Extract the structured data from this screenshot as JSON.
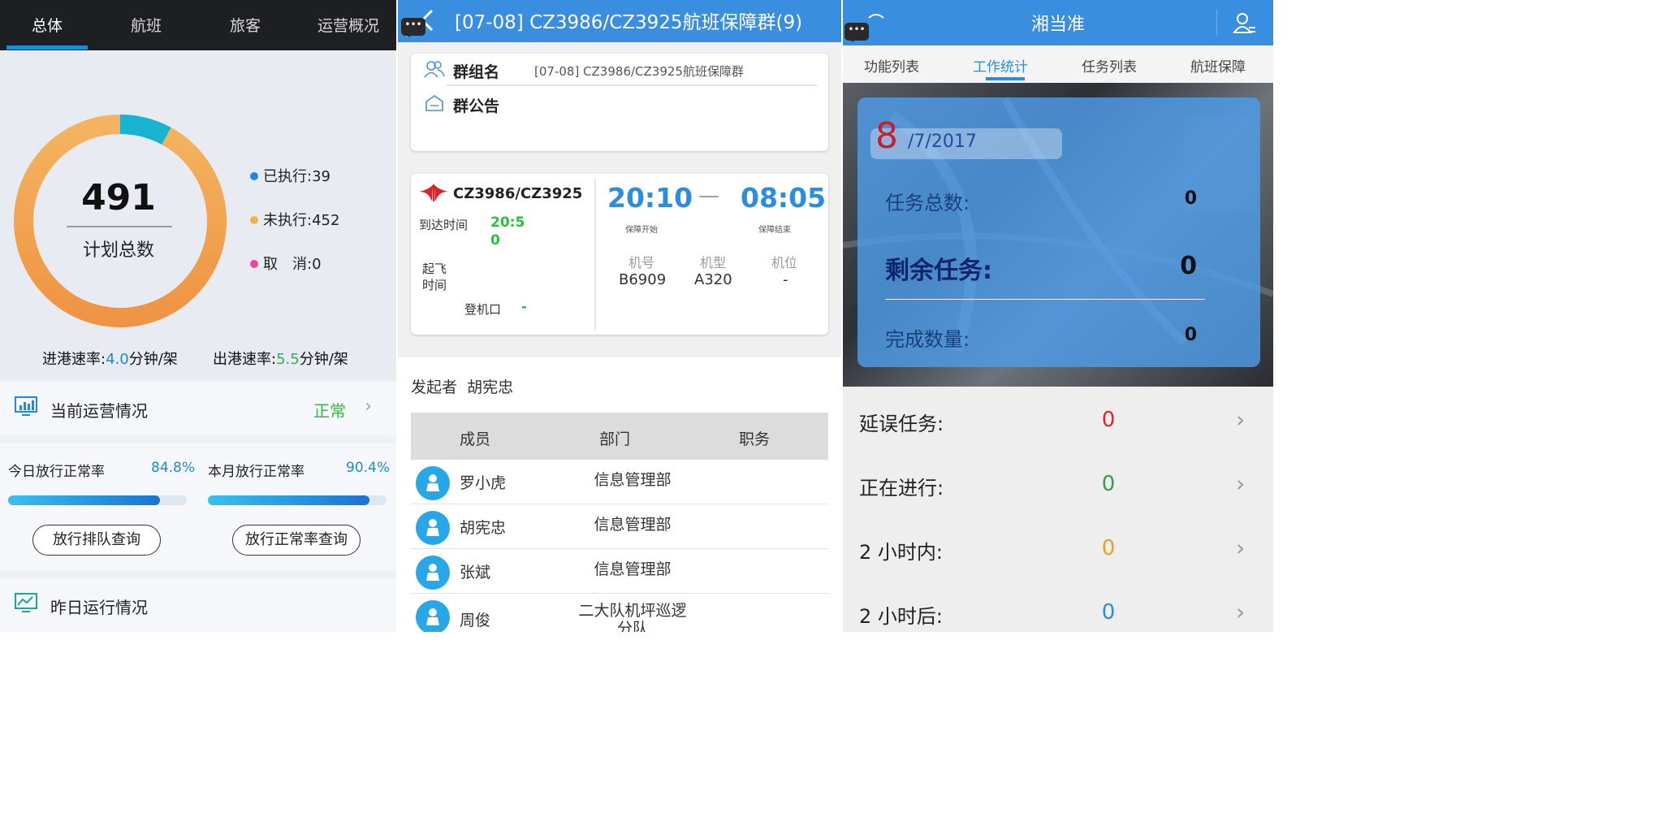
{
  "left": {
    "tabs": [
      "总体",
      "航班",
      "旅客",
      "运营概况"
    ],
    "total_number": "491",
    "total_label": "计划总数",
    "chart_data": {
      "type": "pie",
      "categories": [
        "已执行",
        "未执行",
        "取消"
      ],
      "values": [
        39,
        452,
        0
      ],
      "colors": [
        "#18b3cf",
        "#f2a24b",
        "#e8479a"
      ]
    },
    "legend": {
      "executed": "已执行:39",
      "pending": "未执行:452",
      "cancelled": "取　消:0"
    },
    "rates": {
      "in_label": "进港速率:",
      "in_value": "4.0",
      "in_unit": "分钟/架",
      "out_label": "出港速率:",
      "out_value": "5.5",
      "out_unit": "分钟/架"
    },
    "ops": {
      "title": "当前运营情况",
      "status": "正常"
    },
    "today": {
      "label": "今日放行正常率",
      "value": "84.8%",
      "fraction": 0.848
    },
    "month": {
      "label": "本月放行正常率",
      "value": "90.4%",
      "fraction": 0.904
    },
    "buttons": {
      "queue": "放行排队查询",
      "rate": "放行正常率查询"
    },
    "yesterday": {
      "title": "昨日运行情况"
    }
  },
  "middle": {
    "title": "[07-08] CZ3986/CZ3925航班保障群(9)",
    "chat_icon_text": "•••",
    "group": {
      "name_label": "群组名",
      "name_value": "[07-08] CZ3986/CZ3925航班保障群",
      "notice_label": "群公告"
    },
    "flight": {
      "number": "CZ3986/CZ3925",
      "arrival_label": "到达时间",
      "arrival_value_1": "20:5",
      "arrival_value_2": "0",
      "departure_label_1": "起飞",
      "departure_label_2": "时间",
      "gate_label": "登机口",
      "gate_value": "-",
      "start_time": "20:10",
      "dash": "—",
      "end_time": "08:05",
      "start_label": "保障开始",
      "end_label": "保障结束",
      "reg_label": "机号",
      "reg_value": "B6909",
      "type_label": "机型",
      "type_value": "A320",
      "stand_label": "机位",
      "stand_value": "-"
    },
    "initiator_label": "发起者",
    "initiator_name": "胡宪忠",
    "members_header": [
      "成员",
      "部门",
      "职务"
    ],
    "members": [
      {
        "name": "罗小虎",
        "dept": "信息管理部"
      },
      {
        "name": "胡宪忠",
        "dept": "信息管理部"
      },
      {
        "name": "张斌",
        "dept": "信息管理部"
      },
      {
        "name": "周俊",
        "dept_line1": "二大队机坪巡逻",
        "dept_line2": "分队"
      }
    ]
  },
  "right": {
    "title": "湘当准",
    "chat_icon_text": "•••",
    "tabs": [
      "功能列表",
      "工作统计",
      "任务列表",
      "航班保障"
    ],
    "date_day": "8",
    "date_rest": "/7/2017",
    "stats": [
      {
        "label": "任务总数:",
        "value": "0"
      },
      {
        "label": "剩余任务:",
        "value": "0"
      },
      {
        "label": "完成数量:",
        "value": "0"
      }
    ],
    "tasks": [
      {
        "label": "延误任务:",
        "value": "0",
        "color": "#e0282e"
      },
      {
        "label": "正在进行:",
        "value": "0",
        "color": "#3a9b4a"
      },
      {
        "label": "2 小时内:",
        "value": "0",
        "color": "#f0a020"
      },
      {
        "label": "2 小时后:",
        "value": "0",
        "color": "#2b8de0"
      }
    ]
  }
}
